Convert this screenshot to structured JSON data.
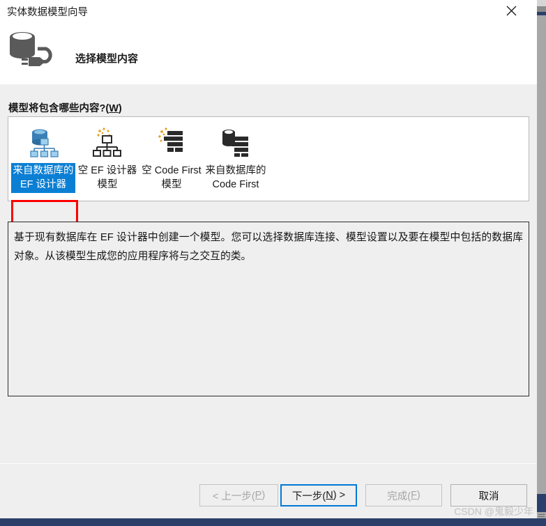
{
  "window": {
    "title": "实体数据模型向导",
    "close_label": "×",
    "header_title": "选择模型内容",
    "header_icon": "database-plug-icon",
    "close_icon": "close-icon"
  },
  "main": {
    "prompt_label_prefix": "模型将包含哪些内容?(",
    "prompt_label_accel": "W",
    "prompt_label_suffix": ")",
    "templates": [
      {
        "id": "ef-designer-from-database",
        "label": "来自数据库的\nEF 设计器",
        "icon": "database-hierarchy-icon",
        "selected": true
      },
      {
        "id": "empty-ef-designer-model",
        "label": "空 EF 设计器\n模型",
        "icon": "hierarchy-sparkle-icon",
        "selected": false
      },
      {
        "id": "empty-code-first-model",
        "label": "空 Code First\n模型",
        "icon": "code-list-sparkle-icon",
        "selected": false
      },
      {
        "id": "code-first-from-database",
        "label": "来自数据库的\nCode First",
        "icon": "database-code-list-icon",
        "selected": false
      }
    ],
    "description": "基于现有数据库在 EF 设计器中创建一个模型。您可以选择数据库连接、模型设置以及要在模型中包括的数据库对象。从该模型生成您的应用程序将与之交互的类。"
  },
  "footer": {
    "buttons": [
      {
        "id": "prev",
        "text_before": "< 上一步(",
        "accel": "P",
        "text_after": ")",
        "disabled": true,
        "default": false
      },
      {
        "id": "next",
        "text_before": "下一步(",
        "accel": "N",
        "text_after": ") >",
        "disabled": false,
        "default": true
      },
      {
        "id": "finish",
        "text_before": "完成(",
        "accel": "F",
        "text_after": ")",
        "disabled": true,
        "default": false
      },
      {
        "id": "cancel",
        "text_before": "取消",
        "accel": "",
        "text_after": "",
        "disabled": false,
        "default": false
      }
    ]
  },
  "watermark": "CSDN @鬼毅少年",
  "colors": {
    "selection_blue": "#0b7fd4",
    "annotation_red": "#fe0000",
    "default_button_border": "#0078d7",
    "taskbar": "#2b3f68"
  }
}
